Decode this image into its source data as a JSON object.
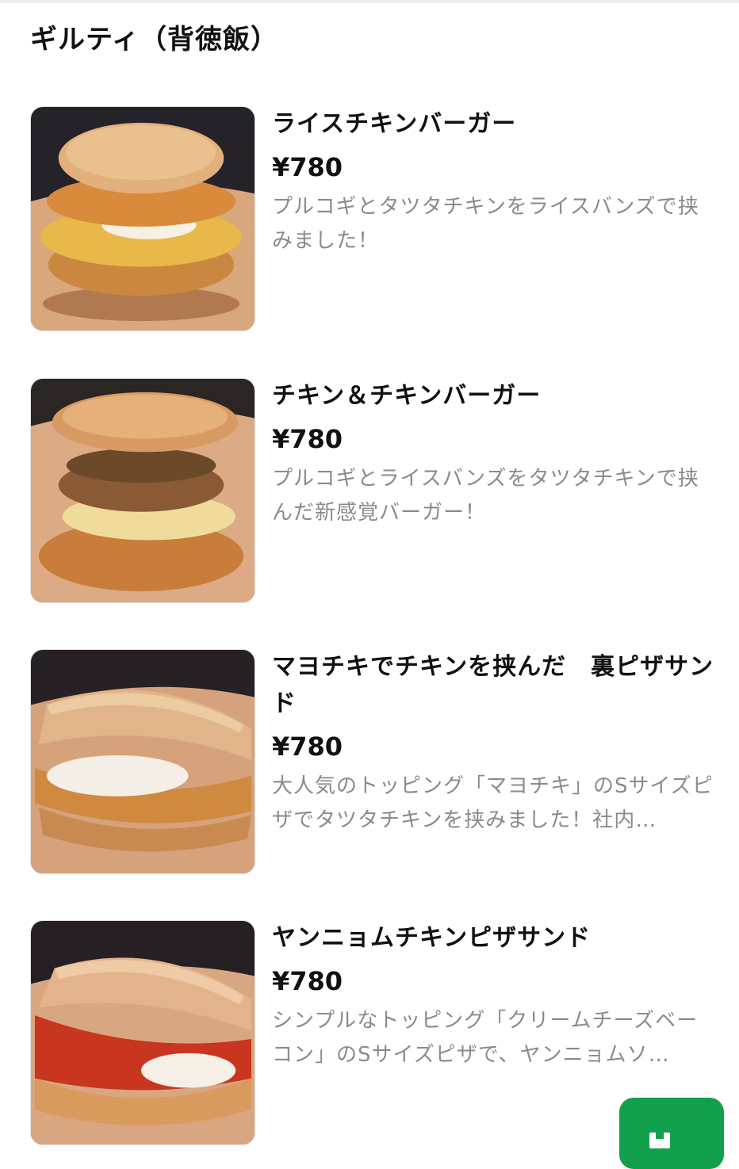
{
  "section": {
    "title": "ギルティ（背徳飯）"
  },
  "menu_items": [
    {
      "name": "ライスチキンバーガー",
      "price": "¥780",
      "description": "プルコギとタツタチキンをライスバンズで挟みました！"
    },
    {
      "name": "チキン＆チキンバーガー",
      "price": "¥780",
      "description": "プルコギとライスバンズをタツタチキンで挟んだ新感覚バーガー！"
    },
    {
      "name": "マヨチキでチキンを挟んだ　裏ピザサンド",
      "price": "¥780",
      "description": "大人気のトッピング「マヨチキ」のSサイズピザでタツタチキンを挟みました！社内…"
    },
    {
      "name": "ヤンニョムチキンピザサンド",
      "price": "¥780",
      "description": "シンプルなトッピング「クリームチーズベーコン」のSサイズピザで、ヤンニョムソ…"
    }
  ],
  "fab": {
    "icon": "cart-icon",
    "color": "#13a04c"
  },
  "colors": {
    "text": "#111111",
    "muted": "#8a8a8a",
    "accent": "#13a04c"
  }
}
